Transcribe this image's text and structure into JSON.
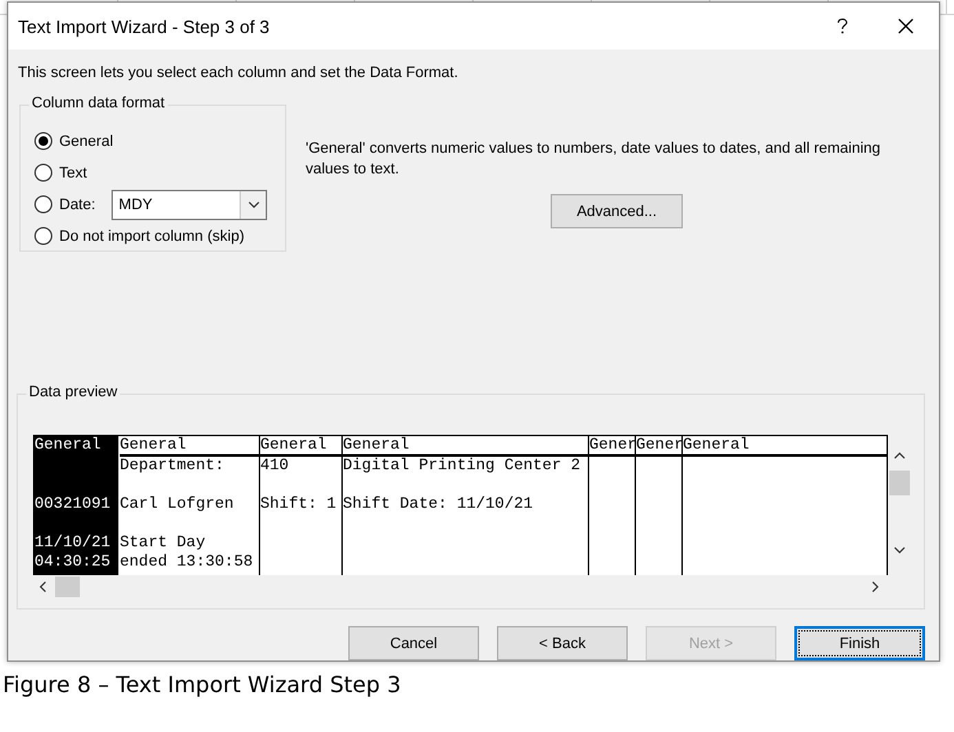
{
  "window": {
    "title": "Text Import Wizard - Step 3 of 3"
  },
  "intro": "This screen lets you select each column and set the Data Format.",
  "column_data_format": {
    "title": "Column data format",
    "options": [
      {
        "kind": "radio",
        "label": "General",
        "selected": true
      },
      {
        "kind": "radio",
        "label": "Text",
        "selected": false
      },
      {
        "kind": "date",
        "label": "Date:",
        "selected": false,
        "value": "MDY"
      },
      {
        "kind": "radio",
        "label": "Do not import column (skip)",
        "selected": false
      }
    ]
  },
  "description": "'General' converts numeric values to numbers, date values to dates, and all remaining values to text.",
  "advanced_button": "Advanced...",
  "data_preview": {
    "title": "Data preview",
    "columns": [
      {
        "header": "General",
        "selected": true
      },
      {
        "header": "General",
        "selected": false
      },
      {
        "header": "General",
        "selected": false
      },
      {
        "header": "General",
        "selected": false
      },
      {
        "header": "Gener",
        "selected": false
      },
      {
        "header": "Gener",
        "selected": false
      },
      {
        "header": "General",
        "selected": false
      }
    ],
    "rows": [
      [
        null,
        "Department:",
        "410",
        "Digital Printing Center 2",
        null,
        null,
        null
      ],
      [
        null,
        null,
        null,
        null,
        null,
        null,
        null
      ],
      [
        "00321091",
        "Carl Lofgren",
        "Shift: 1",
        "Shift Date: 11/10/21",
        null,
        null,
        null
      ],
      [
        null,
        null,
        null,
        null,
        null,
        null,
        null
      ],
      [
        "11/10/21",
        "Start Day",
        null,
        null,
        null,
        null,
        null
      ],
      [
        "04:30:25",
        "ended 13:30:58",
        null,
        null,
        null,
        null,
        null
      ]
    ]
  },
  "buttons": [
    {
      "label": "Cancel",
      "disabled": false,
      "default": false
    },
    {
      "label": "< Back",
      "disabled": false,
      "default": false
    },
    {
      "label": "Next >",
      "disabled": true,
      "default": false
    },
    {
      "label": "Finish",
      "disabled": false,
      "default": true
    }
  ],
  "caption": "Figure 8 – Text Import Wizard Step 3"
}
